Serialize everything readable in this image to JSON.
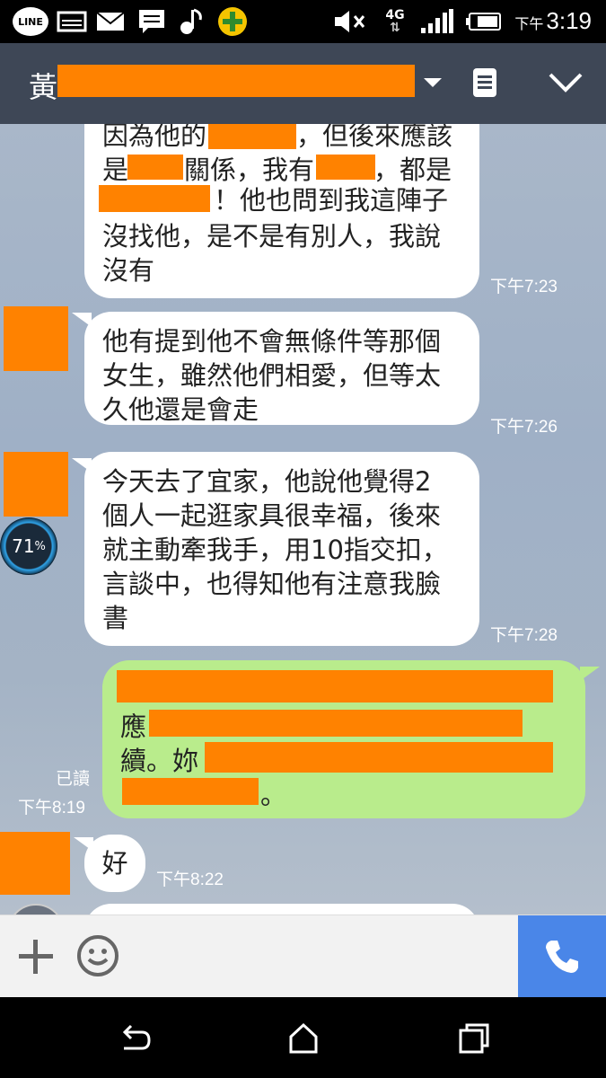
{
  "status_bar": {
    "app_logo": "LINE",
    "ampm": "下午",
    "time": "3:19",
    "network": "4G",
    "icons": [
      "line-icon",
      "image-icon",
      "mail-icon",
      "message-icon",
      "music-icon",
      "plus-badge-icon",
      "mute-icon",
      "network-4g-icon",
      "signal-icon",
      "battery-icon"
    ]
  },
  "header": {
    "contact_name": "黃",
    "icons": [
      "dropdown-icon",
      "notes-icon",
      "chevron-down-icon"
    ]
  },
  "messages": [
    {
      "sender": "them",
      "lines": [
        "因為他的",
        "，但後來應該",
        "是",
        "關係，我有",
        "，都是",
        "！他也問到我這陣子",
        "沒找他，是不是有別人，我說",
        "沒有"
      ],
      "time": "下午7:23"
    },
    {
      "sender": "them",
      "lines": [
        "他有提到他不會無條件等那個",
        "女生，雖然他們相愛，但等太",
        "久他還是會走"
      ],
      "time": "下午7:26"
    },
    {
      "sender": "them",
      "lines": [
        "今天去了宜家，他說他覺得2",
        "個人一起逛家具很幸福，後來",
        "就主動牽我手，用10指交扣，",
        "言談中，也得知他有注意我臉",
        "書"
      ],
      "time": "下午7:28"
    },
    {
      "sender": "me",
      "lines": [
        "應",
        "續。妳",
        "。"
      ],
      "time": "下午8:19",
      "read": "已讀"
    },
    {
      "sender": "them",
      "lines": [
        "好"
      ],
      "time": "下午8:22"
    }
  ],
  "overlay": {
    "battery_percent": "71",
    "percent_sign": "%"
  },
  "input_bar": {
    "icons": [
      "add-icon",
      "emoji-icon",
      "phone-icon"
    ]
  },
  "nav_bar": {
    "icons": [
      "back-icon",
      "home-icon",
      "recents-icon"
    ]
  }
}
